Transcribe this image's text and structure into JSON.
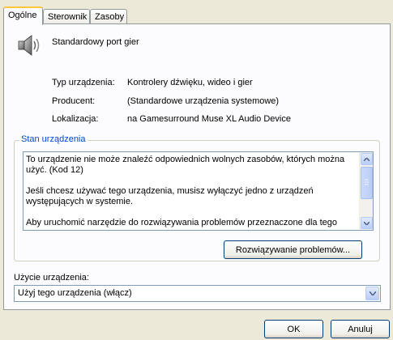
{
  "tabs": [
    {
      "label": "Ogólne",
      "active": true
    },
    {
      "label": "Sterownik",
      "active": false
    },
    {
      "label": "Zasoby",
      "active": false
    }
  ],
  "device": {
    "icon": "speaker-icon",
    "name": "Standardowy port gier"
  },
  "properties": [
    {
      "label": "Typ urządzenia:",
      "value": "Kontrolery dźwięku, wideo i gier"
    },
    {
      "label": "Producent:",
      "value": "(Standardowe urządzenia systemowe)"
    },
    {
      "label": "Lokalizacja:",
      "value": "na Gamesurround Muse XL Audio Device"
    }
  ],
  "status": {
    "group_label": "Stan urządzenia",
    "paragraphs": [
      "To urządzenie nie może znaleźć odpowiednich wolnych zasobów, których można użyć. (Kod 12)",
      "Jeśli chcesz używać tego urządzenia, musisz wyłączyć jedno z urządzeń występujących w systemie.",
      "Aby uruchomić narzędzie do rozwiązywania problemów przeznaczone dla tego"
    ],
    "troubleshoot_button": "Rozwiązywanie problemów..."
  },
  "usage": {
    "label": "Użycie urządzenia:",
    "selected": "Użyj tego urządzenia (włącz)"
  },
  "buttons": {
    "ok": "OK",
    "cancel": "Anuluj"
  },
  "colors": {
    "dialog_bg": "#ECE9D8",
    "panel_bg": "#FCFCFE",
    "group_label": "#0046D5",
    "active_tab_accent": "#FFC83C"
  }
}
